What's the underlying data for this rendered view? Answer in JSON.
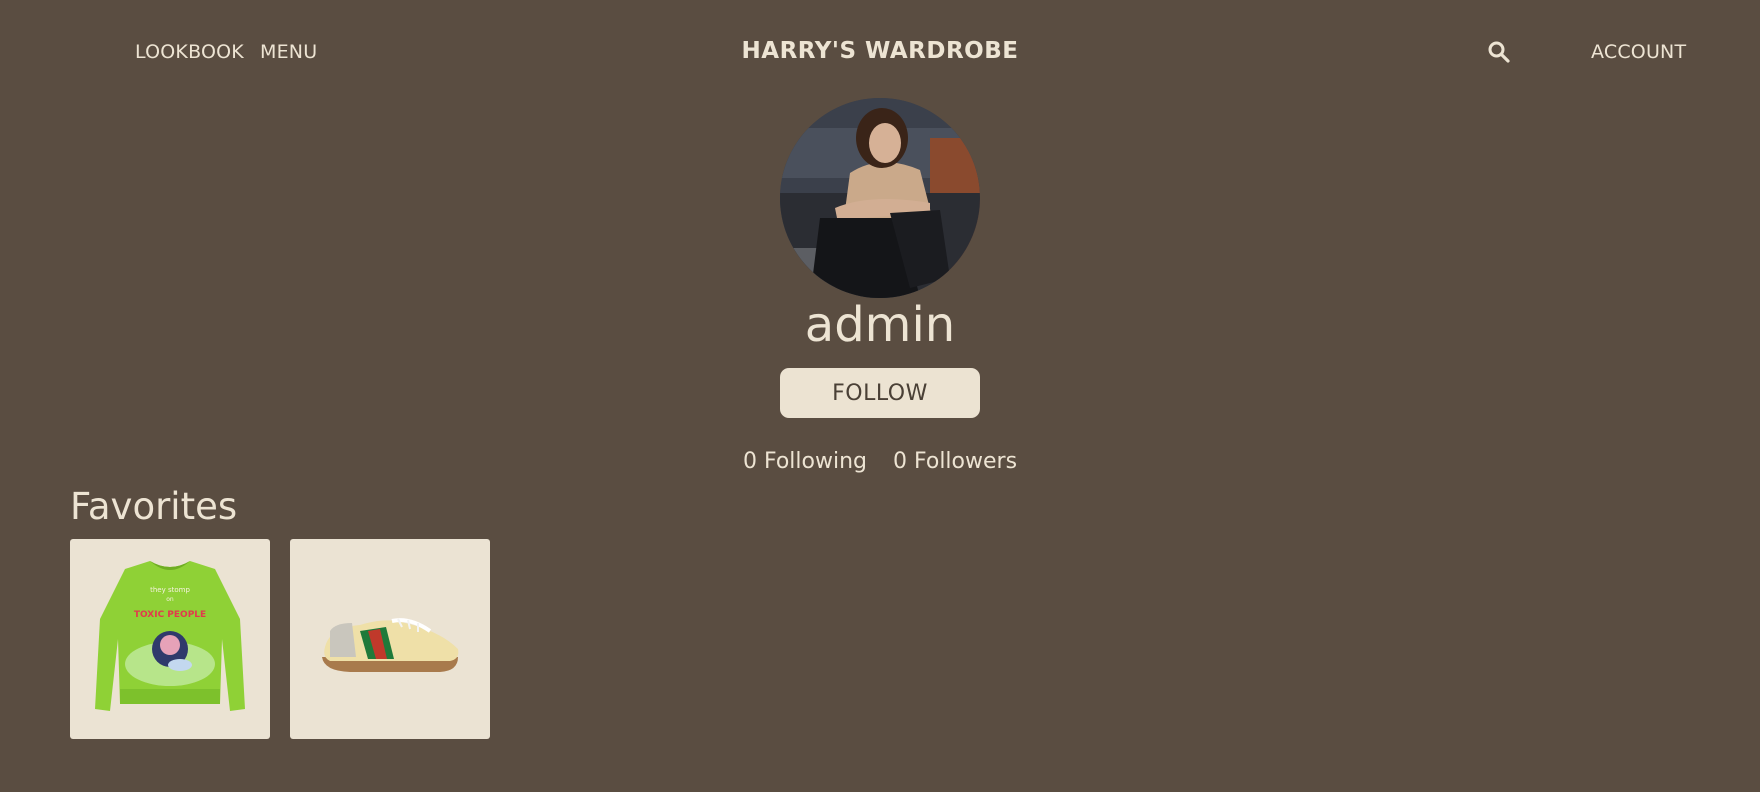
{
  "header": {
    "nav_left": [
      "LOOKBOOK",
      "MENU"
    ],
    "brand": "HARRY'S WARDROBE",
    "search_icon": "search-icon",
    "account": "ACCOUNT"
  },
  "profile": {
    "username": "admin",
    "follow_label": "FOLLOW",
    "following_count": "0",
    "following_label": "Following",
    "followers_count": "0",
    "followers_label": "Followers"
  },
  "favorites": {
    "title": "Favorites",
    "items": [
      {
        "image_text_1": "they stomp",
        "image_text_2": "on",
        "image_text_3": "TOXIC PEOPLE"
      },
      {
        "image_text_1": ""
      }
    ]
  },
  "colors": {
    "background": "#5a4d41",
    "text": "#ede4d3",
    "card": "#ebe3d3",
    "button_text": "#4a4036"
  }
}
